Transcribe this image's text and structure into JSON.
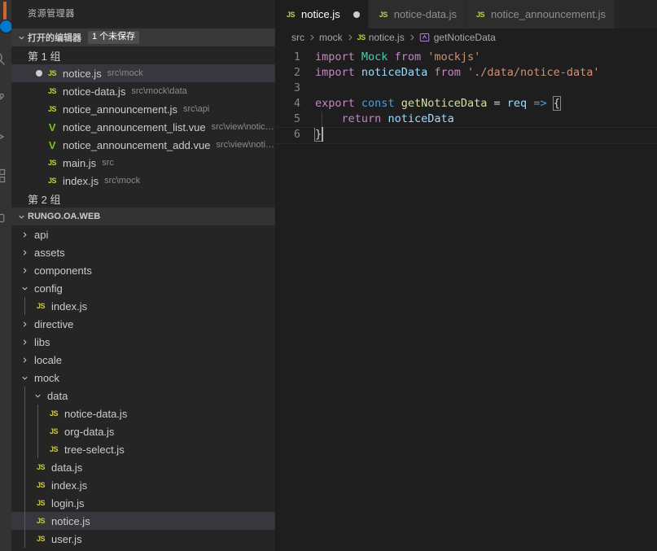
{
  "activity_bar": {
    "items": [
      {
        "name": "explorer-icon"
      },
      {
        "name": "search-icon"
      },
      {
        "name": "source-control-icon"
      },
      {
        "name": "run-debug-icon"
      },
      {
        "name": "extensions-icon"
      }
    ]
  },
  "sidebar": {
    "title": "资源管理器",
    "open_editors": {
      "label": "打开的编辑器",
      "badge": "1 个未保存",
      "groups": [
        {
          "label": "第 1 组",
          "items": [
            {
              "name": "notice.js",
              "desc": "src\\mock",
              "icon": "js",
              "dirty": true,
              "selected": true
            },
            {
              "name": "notice-data.js",
              "desc": "src\\mock\\data",
              "icon": "js",
              "dirty": false,
              "selected": false
            },
            {
              "name": "notice_announcement.js",
              "desc": "src\\api",
              "icon": "js",
              "dirty": false,
              "selected": false
            },
            {
              "name": "notice_announcement_list.vue",
              "desc": "src\\view\\notice...",
              "icon": "vue",
              "dirty": false,
              "selected": false
            },
            {
              "name": "notice_announcement_add.vue",
              "desc": "src\\view\\notic...",
              "icon": "vue",
              "dirty": false,
              "selected": false
            },
            {
              "name": "main.js",
              "desc": "src",
              "icon": "js",
              "dirty": false,
              "selected": false
            },
            {
              "name": "index.js",
              "desc": "src\\mock",
              "icon": "js",
              "dirty": false,
              "selected": false
            }
          ]
        },
        {
          "label": "第 2 组",
          "items": []
        }
      ]
    },
    "workspace": {
      "label": "RUNGO.OA.WEB",
      "tree": [
        {
          "name": "api",
          "type": "folder",
          "expanded": false,
          "depth": 1
        },
        {
          "name": "assets",
          "type": "folder",
          "expanded": false,
          "depth": 1
        },
        {
          "name": "components",
          "type": "folder",
          "expanded": false,
          "depth": 1
        },
        {
          "name": "config",
          "type": "folder",
          "expanded": true,
          "depth": 1
        },
        {
          "name": "index.js",
          "type": "js",
          "depth": 2
        },
        {
          "name": "directive",
          "type": "folder",
          "expanded": false,
          "depth": 1
        },
        {
          "name": "libs",
          "type": "folder",
          "expanded": false,
          "depth": 1
        },
        {
          "name": "locale",
          "type": "folder",
          "expanded": false,
          "depth": 1
        },
        {
          "name": "mock",
          "type": "folder",
          "expanded": true,
          "depth": 1
        },
        {
          "name": "data",
          "type": "folder",
          "expanded": true,
          "depth": 2
        },
        {
          "name": "notice-data.js",
          "type": "js",
          "depth": 3
        },
        {
          "name": "org-data.js",
          "type": "js",
          "depth": 3
        },
        {
          "name": "tree-select.js",
          "type": "js",
          "depth": 3
        },
        {
          "name": "data.js",
          "type": "js",
          "depth": 2
        },
        {
          "name": "index.js",
          "type": "js",
          "depth": 2
        },
        {
          "name": "login.js",
          "type": "js",
          "depth": 2
        },
        {
          "name": "notice.js",
          "type": "js",
          "depth": 2,
          "selected": true
        },
        {
          "name": "user.js",
          "type": "js",
          "depth": 2
        }
      ]
    }
  },
  "editor": {
    "tabs": [
      {
        "label": "notice.js",
        "icon": "js",
        "active": true,
        "dirty": true
      },
      {
        "label": "notice-data.js",
        "icon": "js",
        "active": false,
        "dirty": false
      },
      {
        "label": "notice_announcement.js",
        "icon": "js",
        "active": false,
        "dirty": false
      }
    ],
    "breadcrumbs": [
      {
        "label": "src",
        "icon": "none"
      },
      {
        "label": "mock",
        "icon": "none"
      },
      {
        "label": "notice.js",
        "icon": "js"
      },
      {
        "label": "getNoticeData",
        "icon": "method"
      }
    ],
    "line_numbers": [
      "1",
      "2",
      "3",
      "4",
      "5",
      "6"
    ],
    "code_lines": [
      {
        "n": 1,
        "tokens": [
          {
            "t": "import",
            "c": "kw"
          },
          {
            "t": " ",
            "c": "op"
          },
          {
            "t": "Mock",
            "c": "cls"
          },
          {
            "t": " ",
            "c": "op"
          },
          {
            "t": "from",
            "c": "kw"
          },
          {
            "t": " ",
            "c": "op"
          },
          {
            "t": "'mockjs'",
            "c": "str"
          }
        ]
      },
      {
        "n": 2,
        "tokens": [
          {
            "t": "import",
            "c": "kw"
          },
          {
            "t": " ",
            "c": "op"
          },
          {
            "t": "noticeData",
            "c": "var"
          },
          {
            "t": " ",
            "c": "op"
          },
          {
            "t": "from",
            "c": "kw"
          },
          {
            "t": " ",
            "c": "op"
          },
          {
            "t": "'./data/notice-data'",
            "c": "str"
          }
        ]
      },
      {
        "n": 3,
        "tokens": []
      },
      {
        "n": 4,
        "tokens": [
          {
            "t": "export",
            "c": "kw"
          },
          {
            "t": " ",
            "c": "op"
          },
          {
            "t": "const",
            "c": "kw2"
          },
          {
            "t": " ",
            "c": "op"
          },
          {
            "t": "getNoticeData",
            "c": "fn"
          },
          {
            "t": " ",
            "c": "op"
          },
          {
            "t": "=",
            "c": "op"
          },
          {
            "t": " ",
            "c": "op"
          },
          {
            "t": "req",
            "c": "var"
          },
          {
            "t": " ",
            "c": "op"
          },
          {
            "t": "=>",
            "c": "arrow"
          },
          {
            "t": " ",
            "c": "op"
          },
          {
            "t": "{",
            "c": "brace"
          }
        ]
      },
      {
        "n": 5,
        "tokens": [
          {
            "t": "    ",
            "c": "op"
          },
          {
            "t": "return",
            "c": "kw"
          },
          {
            "t": " ",
            "c": "op"
          },
          {
            "t": "noticeData",
            "c": "var"
          }
        ]
      },
      {
        "n": 6,
        "tokens": [
          {
            "t": "}",
            "c": "brace"
          }
        ]
      }
    ],
    "cursor": {
      "line": 6,
      "column": 2
    }
  },
  "colors": {
    "background": "#1e1e1e",
    "sidebar_bg": "#252526",
    "activitybar_bg": "#333333",
    "selection": "#37373d",
    "accent": "#0078d4",
    "js_icon": "#cbcb41",
    "vue_icon": "#7fc41b"
  }
}
